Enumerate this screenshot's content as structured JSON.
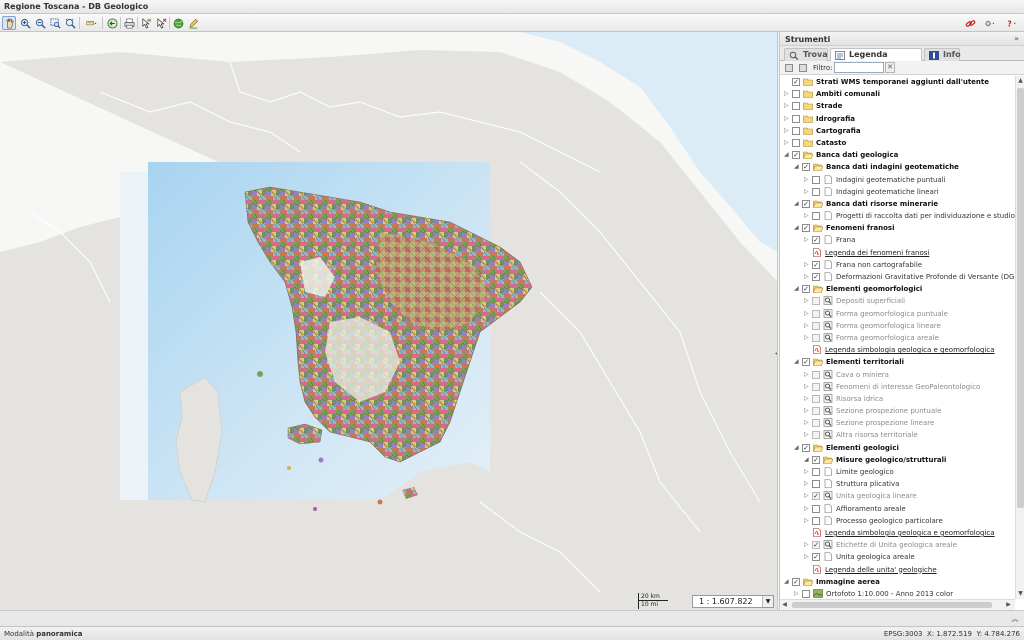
{
  "app": {
    "title": "Regione Toscana - DB Geologico"
  },
  "toolbar": {
    "tools": [
      "pan-tool",
      "zoom-in",
      "zoom-out",
      "zoom-box",
      "zoom-extent",
      "measure",
      "back",
      "print",
      "select",
      "deselect",
      "globe",
      "edit"
    ],
    "right": [
      "link-icon",
      "settings-icon",
      "help-icon"
    ]
  },
  "panel": {
    "title": "Strumenti",
    "tabs": [
      {
        "label": "Trova",
        "icon": "magnifier-icon"
      },
      {
        "label": "Legenda interattiva",
        "icon": "legend-icon",
        "selected": true
      },
      {
        "label": "Info",
        "icon": "info-icon"
      }
    ],
    "filter_label": "Filtro:",
    "filter_value": "",
    "tree": [
      {
        "level": 0,
        "exp": "",
        "checked": true,
        "icon": "folder",
        "label": "Strati WMS temporanei aggiunti dall'utente",
        "style": "b"
      },
      {
        "level": 0,
        "exp": "▷",
        "checked": false,
        "icon": "folder",
        "label": "Ambiti comunali",
        "style": "b"
      },
      {
        "level": 0,
        "exp": "▷",
        "checked": false,
        "icon": "folder",
        "label": "Strade",
        "style": "b"
      },
      {
        "level": 0,
        "exp": "▷",
        "checked": false,
        "icon": "folder",
        "label": "Idrografia",
        "style": "b"
      },
      {
        "level": 0,
        "exp": "▷",
        "checked": false,
        "icon": "folder",
        "label": "Cartografia",
        "style": "b"
      },
      {
        "level": 0,
        "exp": "▷",
        "checked": false,
        "icon": "folder",
        "label": "Catasto",
        "style": "b"
      },
      {
        "level": 0,
        "exp": "◢",
        "checked": true,
        "icon": "folder-open",
        "label": "Banca dati geologica",
        "style": "b"
      },
      {
        "level": 1,
        "exp": "◢",
        "checked": true,
        "icon": "folder-open",
        "label": "Banca dati indagini geotematiche",
        "style": "b"
      },
      {
        "level": 2,
        "exp": "▷",
        "checked": false,
        "icon": "page",
        "label": "Indagini geotematiche puntuali",
        "style": ""
      },
      {
        "level": 2,
        "exp": "▷",
        "checked": false,
        "icon": "page",
        "label": "Indagini geotematiche lineari",
        "style": ""
      },
      {
        "level": 1,
        "exp": "◢",
        "checked": true,
        "icon": "folder-open",
        "label": "Banca dati risorse minerarie",
        "style": "b"
      },
      {
        "level": 2,
        "exp": "▷",
        "checked": false,
        "icon": "page",
        "label": "Progetti di raccolta dati per individuazione e studio risorse minerarie",
        "style": ""
      },
      {
        "level": 1,
        "exp": "◢",
        "checked": true,
        "icon": "folder-open",
        "label": "Fenomeni franosi",
        "style": "b"
      },
      {
        "level": 2,
        "exp": "▷",
        "checked": true,
        "icon": "page",
        "label": "Frana",
        "style": ""
      },
      {
        "level": 2,
        "exp": "",
        "checked": null,
        "icon": "pdf",
        "label": "Legenda dei fenomeni franosi",
        "style": "link"
      },
      {
        "level": 2,
        "exp": "▷",
        "checked": true,
        "icon": "page",
        "label": "Frana non cartografabile",
        "style": ""
      },
      {
        "level": 2,
        "exp": "▷",
        "checked": true,
        "icon": "page",
        "label": "Deformazioni Gravitative Profonde di Versante (DGPV)",
        "style": ""
      },
      {
        "level": 1,
        "exp": "◢",
        "checked": true,
        "icon": "folder-open",
        "label": "Elementi geomorfologici",
        "style": "b"
      },
      {
        "level": 2,
        "exp": "▷",
        "checked": false,
        "icon": "scale",
        "label": "Depositi superficiali",
        "style": "g"
      },
      {
        "level": 2,
        "exp": "▷",
        "checked": false,
        "icon": "scale",
        "label": "Forma geomorfologica puntuale",
        "style": "g"
      },
      {
        "level": 2,
        "exp": "▷",
        "checked": false,
        "icon": "scale",
        "label": "Forma geomorfologica lineare",
        "style": "g"
      },
      {
        "level": 2,
        "exp": "▷",
        "checked": false,
        "icon": "scale",
        "label": "Forma geomorfologica areale",
        "style": "g"
      },
      {
        "level": 2,
        "exp": "",
        "checked": null,
        "icon": "pdf",
        "label": "Legenda simbologia geologica e geomorfologica",
        "style": "link"
      },
      {
        "level": 1,
        "exp": "◢",
        "checked": true,
        "icon": "folder-open",
        "label": "Elementi territoriali",
        "style": "b"
      },
      {
        "level": 2,
        "exp": "▷",
        "checked": false,
        "icon": "scale",
        "label": "Cava o miniera",
        "style": "g"
      },
      {
        "level": 2,
        "exp": "▷",
        "checked": false,
        "icon": "scale",
        "label": "Fenomeni di interesse GeoPaleontologico",
        "style": "g"
      },
      {
        "level": 2,
        "exp": "▷",
        "checked": false,
        "icon": "scale",
        "label": "Risorsa idrica",
        "style": "g"
      },
      {
        "level": 2,
        "exp": "▷",
        "checked": false,
        "icon": "scale",
        "label": "Sezione prospezione puntuale",
        "style": "g"
      },
      {
        "level": 2,
        "exp": "▷",
        "checked": false,
        "icon": "scale",
        "label": "Sezione prospezione lineare",
        "style": "g"
      },
      {
        "level": 2,
        "exp": "▷",
        "checked": false,
        "icon": "scale",
        "label": "Altra risorsa territoriale",
        "style": "g"
      },
      {
        "level": 1,
        "exp": "◢",
        "checked": true,
        "icon": "folder-open",
        "label": "Elementi geologici",
        "style": "b"
      },
      {
        "level": 2,
        "exp": "◢",
        "checked": true,
        "icon": "folder-open",
        "label": "Misure geologico/strutturali",
        "style": "b"
      },
      {
        "level": 2,
        "exp": "▷",
        "checked": false,
        "icon": "page",
        "label": "Limite geologico",
        "style": ""
      },
      {
        "level": 2,
        "exp": "▷",
        "checked": false,
        "icon": "page",
        "label": "Struttura plicativa",
        "style": ""
      },
      {
        "level": 2,
        "exp": "▷",
        "checked": true,
        "icon": "scale",
        "label": "Unita geologica lineare",
        "style": "g"
      },
      {
        "level": 2,
        "exp": "▷",
        "checked": false,
        "icon": "page",
        "label": "Affioramento areale",
        "style": ""
      },
      {
        "level": 2,
        "exp": "▷",
        "checked": false,
        "icon": "page",
        "label": "Processo geologico particolare",
        "style": ""
      },
      {
        "level": 2,
        "exp": "",
        "checked": null,
        "icon": "pdf",
        "label": "Legenda simbologia geologica e geomorfologica",
        "style": "link"
      },
      {
        "level": 2,
        "exp": "▷",
        "checked": true,
        "icon": "scale",
        "label": "Etichette di Unita geologica areale",
        "style": "g"
      },
      {
        "level": 2,
        "exp": "▷",
        "checked": true,
        "icon": "page",
        "label": "Unita geologica areale",
        "style": ""
      },
      {
        "level": 2,
        "exp": "",
        "checked": null,
        "icon": "pdf",
        "label": "Legenda delle unita' geologiche",
        "style": "link"
      },
      {
        "level": 0,
        "exp": "◢",
        "checked": true,
        "icon": "folder-open",
        "label": "Immagine aerea",
        "style": "b"
      },
      {
        "level": 1,
        "exp": "▷",
        "checked": false,
        "icon": "image",
        "label": "Ortofoto 1:10.000 - Anno 2013 color",
        "style": ""
      }
    ]
  },
  "map": {
    "scale_value": "1 : 1.607.822",
    "scalebar_km": "20 km",
    "scalebar_mi": "10 mi"
  },
  "status": {
    "mode_label": "Modalità",
    "mode_value": "panoramica",
    "epsg": "EPSG:3003",
    "x": "X: 1.872.519",
    "y": "Y: 4.784.276"
  },
  "colors": {
    "sea_light": "#dcecf6",
    "sea": "#bfe0f4",
    "land": "#e4e3df",
    "panel_tab_icon": "#3b62a5"
  }
}
